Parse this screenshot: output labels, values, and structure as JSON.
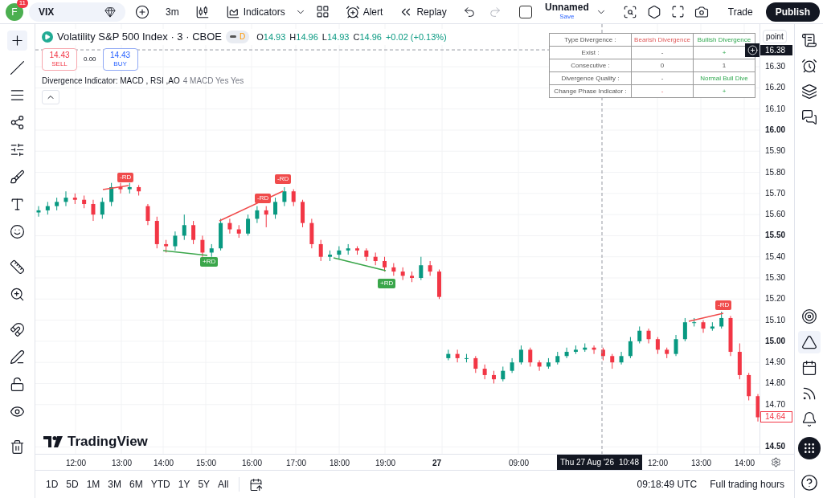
{
  "toolbar": {
    "avatar": "F",
    "notification_count": "11",
    "symbol": "VIX",
    "interval": "3m",
    "indicators": "Indicators",
    "alert": "Alert",
    "replay": "Replay",
    "layout_checked": false,
    "layout_name": "Unnamed",
    "save_status": "Save",
    "trade": "Trade",
    "publish": "Publish"
  },
  "legend": {
    "title": "Volatility S&P 500 Index · 3 · CBOE",
    "badge": "D",
    "ohlc": [
      {
        "label": "O",
        "value": "14.93"
      },
      {
        "label": "H",
        "value": "14.96"
      },
      {
        "label": "L",
        "value": "14.93"
      },
      {
        "label": "C",
        "value": "14.96"
      }
    ],
    "change": "+0.02 (+0.13%)"
  },
  "order": {
    "sell_price": "14.43",
    "sell": "SELL",
    "spread": "0.00",
    "buy_price": "14.43",
    "buy": "BUY"
  },
  "indicator": {
    "name": "Divergence Indicator: MACD , RSI ,AO",
    "params": "4 MACD Yes Yes"
  },
  "table": {
    "header": [
      {
        "text": "Type Divergence :",
        "kind": "neutral"
      },
      {
        "text": "Bearish Divergence",
        "kind": "bearish"
      },
      {
        "text": "Bullish Divergence",
        "kind": "bullish"
      }
    ],
    "rows": [
      {
        "label": "Exist :",
        "cells": [
          {
            "text": "-",
            "kind": "neutral"
          },
          {
            "text": "+",
            "kind": "bullish"
          }
        ]
      },
      {
        "label": "Consecutive :",
        "cells": [
          {
            "text": "0",
            "kind": "neutral"
          },
          {
            "text": "1",
            "kind": "neutral"
          }
        ]
      },
      {
        "label": "Divergence Quality :",
        "cells": [
          {
            "text": "-",
            "kind": "neutral"
          },
          {
            "text": "Normal Bull Dive",
            "kind": "bullish"
          }
        ]
      },
      {
        "label": "Change Phase Indicator :",
        "cells": [
          {
            "text": "-",
            "kind": "bearish"
          },
          {
            "text": "+",
            "kind": "bullish"
          }
        ]
      }
    ]
  },
  "chart_data": {
    "type": "candlestick",
    "ylim": [
      14.467,
      16.502
    ],
    "grid": true,
    "ref_lines": [
      {
        "axis": "y",
        "value": 16.38
      }
    ],
    "yticks": [
      {
        "value": 16.3,
        "label": "16.30"
      },
      {
        "value": 16.2,
        "label": "16.20"
      },
      {
        "value": 16.1,
        "label": "16.10"
      },
      {
        "value": 16.0,
        "label": "16.00"
      },
      {
        "value": 15.9,
        "label": "15.90"
      },
      {
        "value": 15.8,
        "label": "15.80"
      },
      {
        "value": 15.7,
        "label": "15.70"
      },
      {
        "value": 15.6,
        "label": "15.60"
      },
      {
        "value": 15.5,
        "label": "15.50"
      },
      {
        "value": 15.4,
        "label": "15.40"
      },
      {
        "value": 15.3,
        "label": "15.30"
      },
      {
        "value": 15.2,
        "label": "15.20"
      },
      {
        "value": 15.1,
        "label": "15.10"
      },
      {
        "value": 15.0,
        "label": "15.00"
      },
      {
        "value": 14.9,
        "label": "14.90"
      },
      {
        "value": 14.8,
        "label": "14.80"
      },
      {
        "value": 14.7,
        "label": "14.70"
      },
      {
        "value": 14.5,
        "label": "14.50"
      }
    ],
    "categories": [
      null,
      null,
      null,
      null,
      null,
      null,
      null,
      null,
      null,
      null,
      null,
      null,
      null,
      null,
      null,
      null,
      null,
      null,
      null,
      null,
      null,
      null,
      null,
      null,
      null,
      null,
      null,
      null,
      null,
      null,
      null,
      null,
      null,
      null,
      null,
      null,
      null,
      null,
      null,
      null,
      null,
      null,
      null,
      null,
      null,
      null,
      null,
      null,
      null,
      null,
      null,
      null,
      null,
      null,
      null,
      null,
      null,
      null,
      null,
      null,
      null,
      null,
      null,
      null,
      null,
      null,
      null,
      null,
      null,
      null,
      null,
      null,
      null,
      null,
      null,
      null,
      null,
      null,
      null,
      null
    ],
    "ohlc": [
      [
        15.61,
        15.64,
        15.59,
        15.62
      ],
      [
        15.62,
        15.66,
        15.6,
        15.64
      ],
      [
        15.64,
        15.68,
        15.62,
        15.66
      ],
      [
        15.66,
        15.71,
        15.64,
        15.68
      ],
      [
        15.68,
        15.7,
        15.65,
        15.67
      ],
      [
        15.67,
        15.69,
        15.63,
        15.65
      ],
      [
        15.65,
        15.67,
        15.57,
        15.6
      ],
      [
        15.6,
        15.68,
        15.58,
        15.66
      ],
      [
        15.66,
        15.75,
        15.64,
        15.73
      ],
      [
        15.73,
        15.75,
        15.7,
        15.72
      ],
      [
        15.72,
        15.75,
        15.7,
        15.73
      ],
      [
        15.73,
        15.74,
        15.69,
        15.71
      ],
      [
        15.64,
        15.65,
        15.55,
        15.57
      ],
      [
        15.57,
        15.59,
        15.44,
        15.46
      ],
      [
        15.46,
        15.48,
        15.42,
        15.45
      ],
      [
        15.45,
        15.52,
        15.43,
        15.5
      ],
      [
        15.5,
        15.6,
        15.48,
        15.55
      ],
      [
        15.55,
        15.57,
        15.46,
        15.48
      ],
      [
        15.48,
        15.5,
        15.4,
        15.42
      ],
      [
        15.42,
        15.46,
        15.4,
        15.44
      ],
      [
        15.44,
        15.58,
        15.43,
        15.56
      ],
      [
        15.56,
        15.58,
        15.51,
        15.53
      ],
      [
        15.53,
        15.55,
        15.49,
        15.51
      ],
      [
        15.51,
        15.6,
        15.5,
        15.58
      ],
      [
        15.58,
        15.64,
        15.56,
        15.62
      ],
      [
        15.62,
        15.64,
        15.54,
        15.6
      ],
      [
        15.6,
        15.68,
        15.58,
        15.66
      ],
      [
        15.66,
        15.73,
        15.64,
        15.71
      ],
      [
        15.71,
        15.72,
        15.64,
        15.66
      ],
      [
        15.66,
        15.67,
        15.54,
        15.56
      ],
      [
        15.56,
        15.58,
        15.44,
        15.46
      ],
      [
        15.46,
        15.48,
        15.38,
        15.4
      ],
      [
        15.4,
        15.43,
        15.38,
        15.41
      ],
      [
        15.41,
        15.45,
        15.39,
        15.43
      ],
      [
        15.43,
        15.46,
        15.41,
        15.44
      ],
      [
        15.44,
        15.45,
        15.41,
        15.43
      ],
      [
        15.43,
        15.44,
        15.38,
        15.4
      ],
      [
        15.4,
        15.42,
        15.36,
        15.38
      ],
      [
        15.38,
        15.4,
        15.33,
        15.35
      ],
      [
        15.35,
        15.37,
        15.31,
        15.33
      ],
      [
        15.33,
        15.35,
        15.29,
        15.31
      ],
      [
        15.31,
        15.33,
        15.28,
        15.3
      ],
      [
        15.3,
        15.4,
        15.29,
        15.36
      ],
      [
        15.36,
        15.38,
        15.31,
        15.33
      ],
      [
        15.33,
        15.34,
        15.2,
        15.21
      ],
      [
        14.92,
        14.96,
        14.91,
        14.94
      ],
      [
        14.94,
        14.96,
        14.9,
        14.92
      ],
      [
        14.92,
        14.94,
        14.9,
        14.92
      ],
      [
        14.92,
        14.93,
        14.85,
        14.87
      ],
      [
        14.87,
        14.89,
        14.82,
        14.84
      ],
      [
        14.84,
        14.86,
        14.8,
        14.82
      ],
      [
        14.82,
        14.88,
        14.81,
        14.86
      ],
      [
        14.86,
        14.92,
        14.85,
        14.9
      ],
      [
        14.9,
        14.98,
        14.89,
        14.96
      ],
      [
        14.96,
        14.97,
        14.88,
        14.9
      ],
      [
        14.9,
        14.91,
        14.86,
        14.88
      ],
      [
        14.88,
        14.92,
        14.87,
        14.9
      ],
      [
        14.9,
        14.95,
        14.89,
        14.93
      ],
      [
        14.93,
        14.97,
        14.92,
        14.95
      ],
      [
        14.95,
        14.98,
        14.94,
        14.96
      ],
      [
        14.96,
        14.99,
        14.95,
        14.97
      ],
      [
        14.97,
        14.98,
        14.94,
        14.96
      ],
      [
        14.96,
        14.97,
        14.91,
        14.93
      ],
      [
        14.93,
        14.94,
        14.87,
        14.9
      ],
      [
        14.9,
        14.95,
        14.89,
        14.93
      ],
      [
        14.93,
        15.02,
        14.92,
        15.0
      ],
      [
        15.0,
        15.07,
        14.99,
        15.05
      ],
      [
        15.05,
        15.06,
        14.99,
        15.01
      ],
      [
        15.01,
        15.02,
        14.94,
        14.96
      ],
      [
        14.96,
        14.97,
        14.92,
        14.94
      ],
      [
        14.94,
        15.03,
        14.93,
        15.01
      ],
      [
        15.01,
        15.11,
        15.0,
        15.09
      ],
      [
        15.09,
        15.11,
        15.07,
        15.09
      ],
      [
        15.09,
        15.1,
        15.04,
        15.06
      ],
      [
        15.06,
        15.09,
        15.05,
        15.07
      ],
      [
        15.07,
        15.14,
        15.06,
        15.11
      ],
      [
        15.11,
        15.12,
        14.93,
        14.95
      ],
      [
        14.95,
        14.99,
        14.82,
        14.84
      ],
      [
        14.84,
        14.85,
        14.72,
        14.74
      ],
      [
        14.74,
        14.75,
        14.62,
        14.64
      ]
    ]
  },
  "divergences": [
    {
      "label": "-RD",
      "kind": "bearish"
    },
    {
      "label": "-RD",
      "kind": "bearish"
    },
    {
      "label": "-RD",
      "kind": "bearish"
    },
    {
      "label": "+RD",
      "kind": "bullish"
    },
    {
      "label": "+RD",
      "kind": "bullish"
    },
    {
      "label": "-RD",
      "kind": "bearish"
    }
  ],
  "logo_text": "TradingView",
  "price_axis": {
    "unit": "point",
    "crosshair_price": "16.38",
    "last_price": "14.64",
    "labels": [
      {
        "bold": false
      },
      {
        "bold": false
      },
      {
        "bold": false
      },
      {
        "bold": true
      },
      {
        "bold": false
      },
      {
        "bold": false
      },
      {
        "bold": false
      },
      {
        "bold": false
      },
      {
        "bold": true
      },
      {
        "bold": false
      },
      {
        "bold": false
      },
      {
        "bold": false
      },
      {
        "bold": false
      },
      {
        "bold": true
      },
      {
        "bold": false
      },
      {
        "bold": false
      },
      {
        "bold": false
      },
      {
        "bold": true
      }
    ]
  },
  "time_axis": {
    "crosshair_date": "Thu 27 Aug '26",
    "crosshair_time": "10:48",
    "labels": [
      {
        "text": "12:00",
        "bold": false
      },
      {
        "text": "13:00",
        "bold": false
      },
      {
        "text": "14:00",
        "bold": false
      },
      {
        "text": "15:00",
        "bold": false
      },
      {
        "text": "16:00",
        "bold": false
      },
      {
        "text": "17:00",
        "bold": false
      },
      {
        "text": "18:00",
        "bold": false
      },
      {
        "text": "19:00",
        "bold": false
      },
      {
        "text": "27",
        "bold": true
      },
      {
        "text": "09:00",
        "bold": false
      },
      {
        "text": "12:00",
        "bold": false
      },
      {
        "text": "13:00",
        "bold": false
      },
      {
        "text": "14:00",
        "bold": false
      }
    ]
  },
  "ranges": [
    "1D",
    "5D",
    "1M",
    "3M",
    "6M",
    "YTD",
    "1Y",
    "5Y",
    "All"
  ],
  "clock": "09:18:49 UTC",
  "session": "Full trading hours"
}
